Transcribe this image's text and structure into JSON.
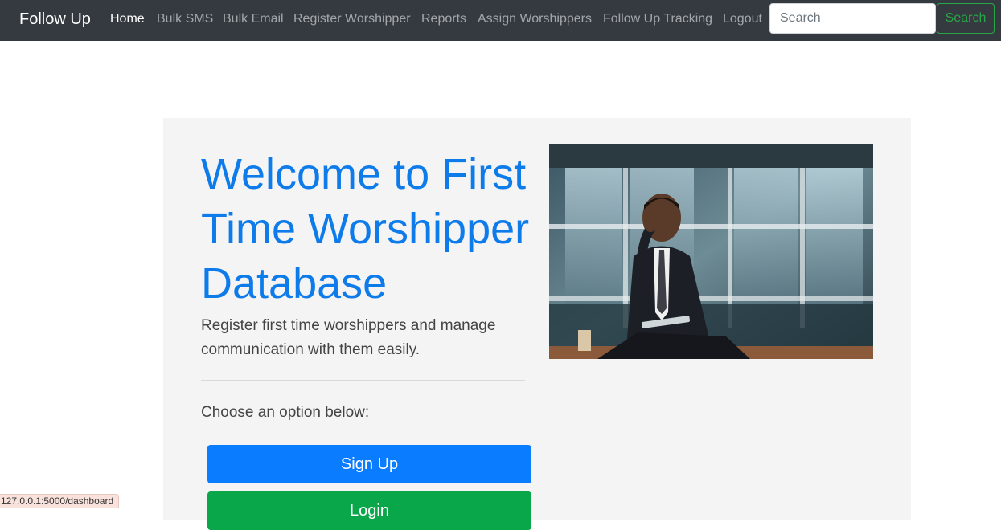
{
  "nav": {
    "brand": "Follow Up",
    "items": [
      {
        "label": "Home",
        "active": true
      },
      {
        "label": "Bulk SMS"
      },
      {
        "label": "Bulk Email"
      },
      {
        "label": "Register Worshipper"
      },
      {
        "label": "Reports"
      },
      {
        "label": "Assign Worshippers"
      },
      {
        "label": "Follow Up Tracking"
      },
      {
        "label": "Logout"
      }
    ],
    "search_placeholder": "Search",
    "search_button": "Search"
  },
  "hero": {
    "title": "Welcome to First Time Worshipper Database",
    "lead": "Register first time worshippers and manage communication with them easily.",
    "prompt": "Choose an option below:",
    "signup_label": "Sign Up",
    "login_label": "Login",
    "image_description": "Smiling man in suit talking on phone holding a tablet"
  },
  "status_bar": {
    "url": "127.0.0.1:5000/dashboard"
  },
  "colors": {
    "navbar_bg": "#343a40",
    "primary": "#0a7cff",
    "success": "#0aa64a",
    "title": "#0d7bea",
    "jumbotron_bg": "#f4f4f4"
  }
}
